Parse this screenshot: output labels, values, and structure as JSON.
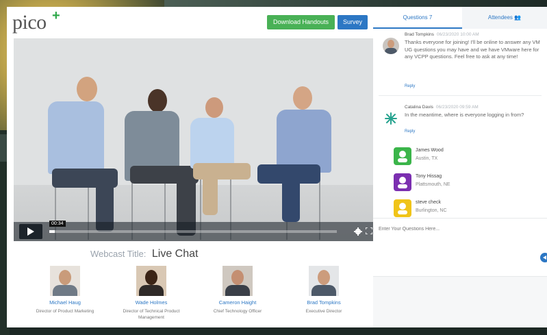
{
  "app": {
    "logo_text": "pico",
    "logo_plus": "+"
  },
  "toolbar": {
    "handouts_label": "Download Handouts",
    "survey_label": "Survey"
  },
  "video": {
    "timestamp": "00:34",
    "progress_fraction": 0.02
  },
  "webcast": {
    "title_label": "Webcast Title:",
    "title_value": "Live Chat"
  },
  "speakers": [
    {
      "name": "Michael Haug",
      "role": "Director of Product Marketing"
    },
    {
      "name": "Wade Holmes",
      "role": "Director of Technical Product Management"
    },
    {
      "name": "Cameron Haight",
      "role": "Chief Technology Officer"
    },
    {
      "name": "Brad Tompkins",
      "role": "Executive Director"
    }
  ],
  "side": {
    "tabs": [
      {
        "label": "Questions  7"
      },
      {
        "label": "Attendees  👥"
      }
    ],
    "messages": [
      {
        "author": "Brad Tompkins",
        "time": "06/23/2020 10:00 AM",
        "text": "Thanks everyone for joining! I'll be online to answer any VM UG questions you may have and we have VMware here for any VCPP questions. Feel free to ask at any time!",
        "reply": "Reply"
      },
      {
        "author": "Catalina Davis",
        "time": "06/23/2020 09:59 AM",
        "text": "In the meantime, where is everyone logging in from?",
        "reply": "Reply"
      }
    ],
    "attendees": [
      {
        "name": "James Wood",
        "location": "Austin, TX",
        "color": "#3bb54a"
      },
      {
        "name": "Tony Hissag",
        "location": "Plattsmouth, NE",
        "color": "#7b2fb0"
      },
      {
        "name": "steve check",
        "location": "Burlington, NC",
        "color": "#f0c419"
      }
    ],
    "ask_placeholder": "Enter Your Questions Here..."
  },
  "colors": {
    "accent_blue": "#2c77c4",
    "accent_green": "#49b156"
  }
}
